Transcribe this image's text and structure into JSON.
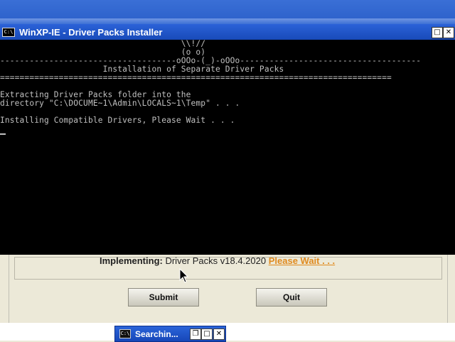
{
  "console": {
    "window_title": "WinXP-IE - Driver Packs Installer",
    "icon": "console-icon",
    "icon_text": "C:\\",
    "art_line_1": "                                     \\\\!//",
    "art_line_2": "                                     (o o)",
    "art_line_3": "------------------------------------oOOo-(_)-oOOo-------------------------------------",
    "heading": "                     Installation of Separate Driver Packs",
    "separator": "================================================================================",
    "blank": "",
    "extract_line_1": "Extracting Driver Packs folder into the",
    "extract_line_2": "directory \"C:\\DOCUME~1\\Admin\\LOCALS~1\\Temp\" . . .",
    "install_line": "Installing Compatible Drivers, Please Wait . . ."
  },
  "installer": {
    "implementing_label": "Implementing:",
    "implementing_value": "Driver Packs v18.4.2020",
    "please_wait": "Please Wait . . .",
    "submit_label": "Submit",
    "quit_label": "Quit"
  },
  "taskbar": {
    "minimized_title": "Searchin...",
    "icon": "console-icon",
    "icon_text": "C:\\"
  },
  "colors": {
    "console_bg": "#000000",
    "console_text": "#c0c0c0",
    "titlebar_blue": "#2458c8",
    "wait_orange": "#e08a1e"
  }
}
